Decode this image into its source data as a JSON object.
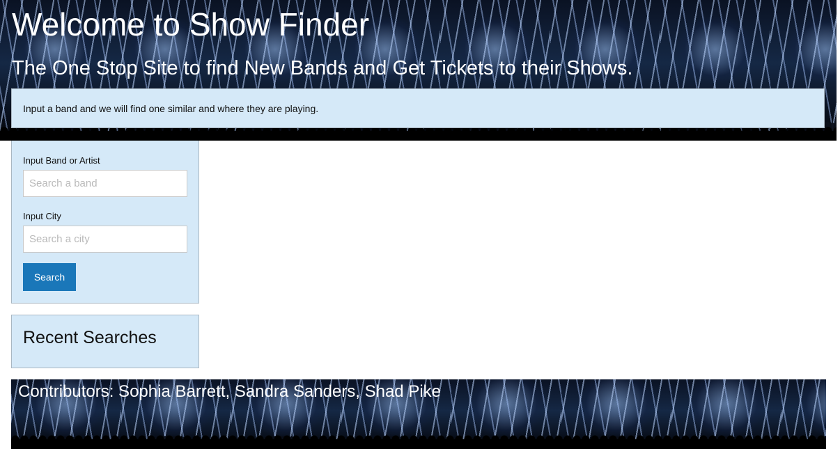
{
  "header": {
    "title": "Welcome to Show Finder",
    "subtitle": "The One Stop Site to find New Bands and Get Tickets to their Shows.",
    "intro": "Input a band and we will find one similar and where they are playing."
  },
  "search_form": {
    "band_label": "Input Band or Artist",
    "band_placeholder": "Search a band",
    "band_value": "",
    "city_label": "Input City",
    "city_placeholder": "Search a city",
    "city_value": "",
    "button_label": "Search"
  },
  "recent_searches": {
    "title": "Recent Searches",
    "items": []
  },
  "footer": {
    "contributors": "Contributors: Sophia Barrett, Sandra Sanders, Shad Pike"
  },
  "colors": {
    "panel_background": "#d5e9f8",
    "panel_border": "#a9b7c2",
    "button_background": "#1a77b9",
    "heading_text": "#ffffff"
  },
  "icons": {
    "hero_background": "concert-stage-image",
    "footer_background": "concert-stage-image"
  }
}
